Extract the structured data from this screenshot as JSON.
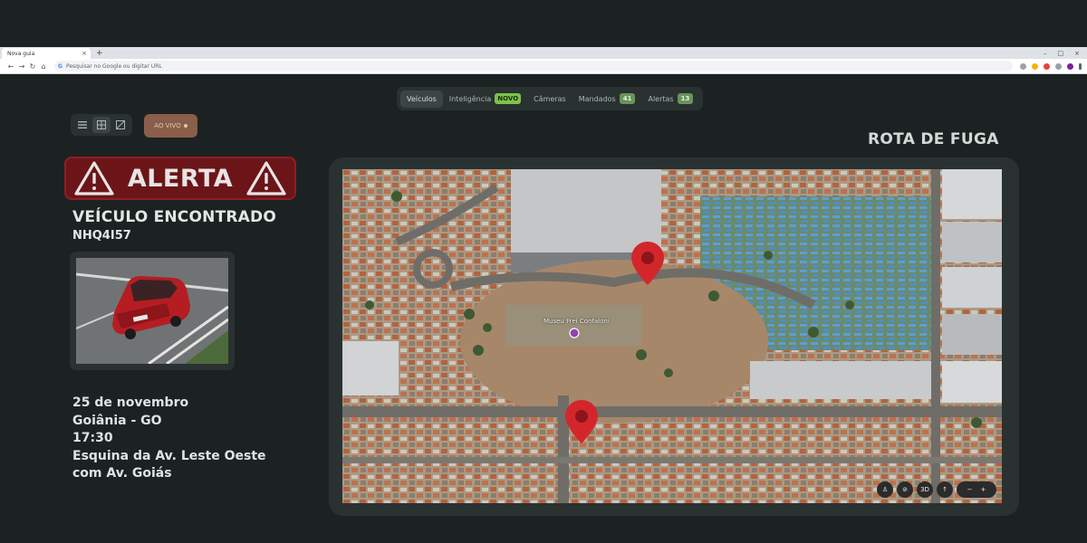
{
  "browser": {
    "tab_title": "Nova guia",
    "tab_close": "×",
    "new_tab": "+",
    "omnibox_placeholder": "Pesquisar no Google ou digitar URL",
    "window_controls": [
      "–",
      "□",
      "×"
    ]
  },
  "nav": {
    "items": [
      {
        "label": "Veículos",
        "active": true
      },
      {
        "label": "Inteligência",
        "badge": "NOVO"
      },
      {
        "label": "Câmeras"
      },
      {
        "label": "Mandados",
        "badge": "41"
      },
      {
        "label": "Alertas",
        "badge": "13"
      }
    ]
  },
  "controls": {
    "live_label": "AO VIVO",
    "view_icons": [
      "list-icon",
      "grid-icon",
      "image-icon"
    ]
  },
  "alert": {
    "label": "ALERTA",
    "title": "VEÍCULO ENCONTRADO",
    "plate": "NHQ4I57",
    "details": [
      "25 de novembro",
      "Goiânia - GO",
      "17:30",
      "Esquina da Av. Leste Oeste",
      "com Av. Goiás"
    ]
  },
  "route": {
    "title": "ROTA DE FUGA",
    "map_labels": [
      "Museu Frei Confaloni"
    ],
    "map_controls": [
      "3D"
    ],
    "pins": 2
  },
  "colors": {
    "background": "#1c2222",
    "panel": "#2a3131",
    "alert_red": "#6b1519",
    "badge_green": "#7ec24a",
    "pin_red": "#d3262b",
    "highlight_blue": "#5a9fd6"
  }
}
